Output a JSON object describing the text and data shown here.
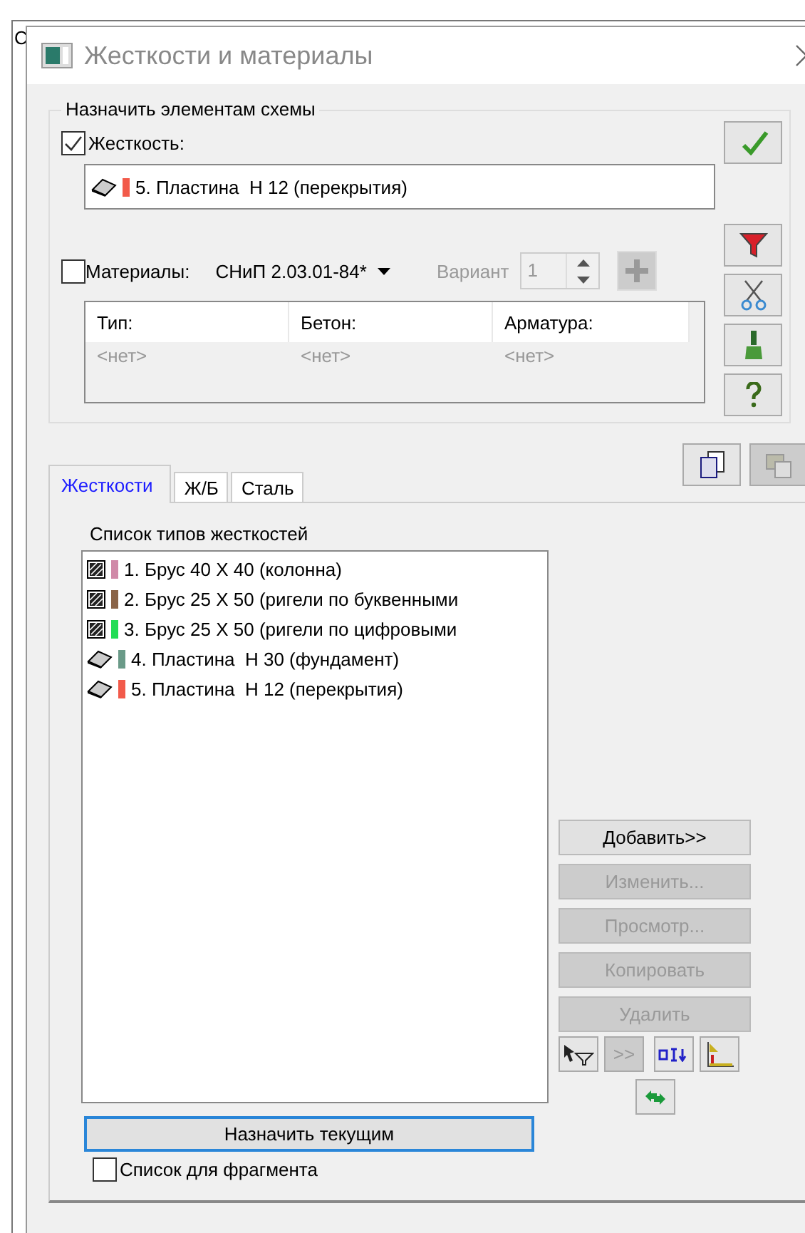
{
  "background_fragment": "С",
  "window": {
    "title": "Жесткости и материалы"
  },
  "assign_group": {
    "title": "Назначить элементам схемы",
    "stiffness": {
      "label": "Жесткость:",
      "checked": true,
      "value": {
        "kind": "plate",
        "color": "#f25a4a",
        "text": "5. Пластина  Н 12 (перекрытия)"
      }
    },
    "materials": {
      "label": "Материалы:",
      "checked": false,
      "standard": "СНиП 2.03.01-84*",
      "variant_label": "Вариант",
      "variant_value": "1",
      "disabled": true
    },
    "materials_table": {
      "columns": [
        "Тип:",
        "Бетон:",
        "Арматура:"
      ],
      "rows": [
        [
          "<нет>",
          "<нет>",
          "<нет>"
        ]
      ]
    }
  },
  "tabs": [
    {
      "label": "Жесткости",
      "selected": true
    },
    {
      "label": "Ж/Б",
      "selected": false
    },
    {
      "label": "Сталь",
      "selected": false
    }
  ],
  "stiffness_list": {
    "title": "Список типов жесткостей",
    "items": [
      {
        "kind": "beam",
        "color": "#d08aa8",
        "text": "1. Брус 40 X 40 (колонна)"
      },
      {
        "kind": "beam",
        "color": "#8a6448",
        "text": "2. Брус 25 X 50 (ригели по буквенными"
      },
      {
        "kind": "beam",
        "color": "#22dd55",
        "text": "3. Брус 25 X 50 (ригели по цифровыми"
      },
      {
        "kind": "plate",
        "color": "#6a9a88",
        "text": "4. Пластина  Н 30 (фундамент)"
      },
      {
        "kind": "plate",
        "color": "#f25a4a",
        "text": "5. Пластина  Н 12 (перекрытия)"
      }
    ]
  },
  "actions": [
    {
      "label": "Добавить>>",
      "disabled": false
    },
    {
      "label": "Изменить...",
      "disabled": true
    },
    {
      "label": "Просмотр...",
      "disabled": true
    },
    {
      "label": "Копировать",
      "disabled": true
    },
    {
      "label": "Удалить",
      "disabled": true
    }
  ],
  "move_button": {
    "label": ">>",
    "disabled": true
  },
  "assign_current": {
    "label": "Назначить текущим"
  },
  "fragment_list": {
    "label": "Список для фрагмента",
    "checked": false
  }
}
